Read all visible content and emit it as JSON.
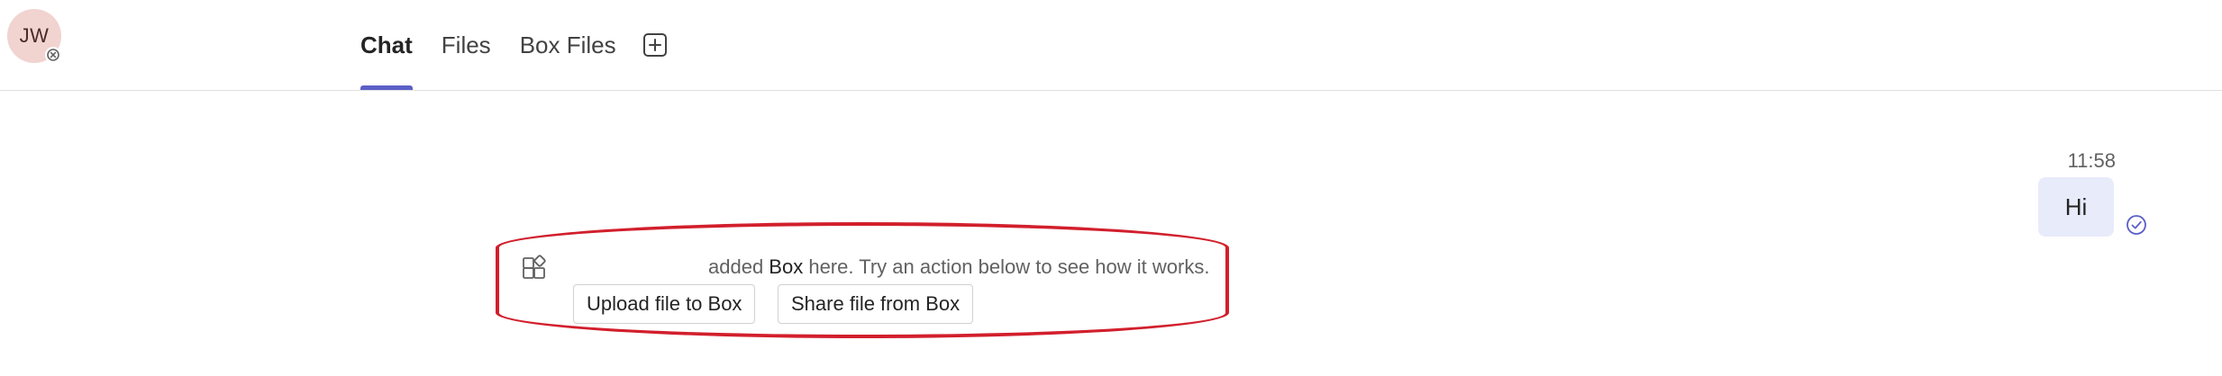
{
  "user": {
    "initials": "JW"
  },
  "tabs": [
    {
      "label": "Chat",
      "active": true
    },
    {
      "label": "Files",
      "active": false
    },
    {
      "label": "Box Files",
      "active": false
    }
  ],
  "message": {
    "time": "11:58",
    "text": "Hi"
  },
  "system_message": {
    "prefix": "added ",
    "app_name": "Box",
    "suffix": " here. Try an action below to see how it works.",
    "actions": [
      "Upload file to Box",
      "Share file from Box"
    ]
  },
  "colors": {
    "accent": "#5b5fc7",
    "bubble": "#e8ebfa",
    "highlight": "#d21f2c",
    "avatar_bg": "#f1d3cf"
  },
  "icons": [
    "presence-offline-icon",
    "add-tab-icon",
    "seen-check-icon",
    "apps-icon"
  ]
}
